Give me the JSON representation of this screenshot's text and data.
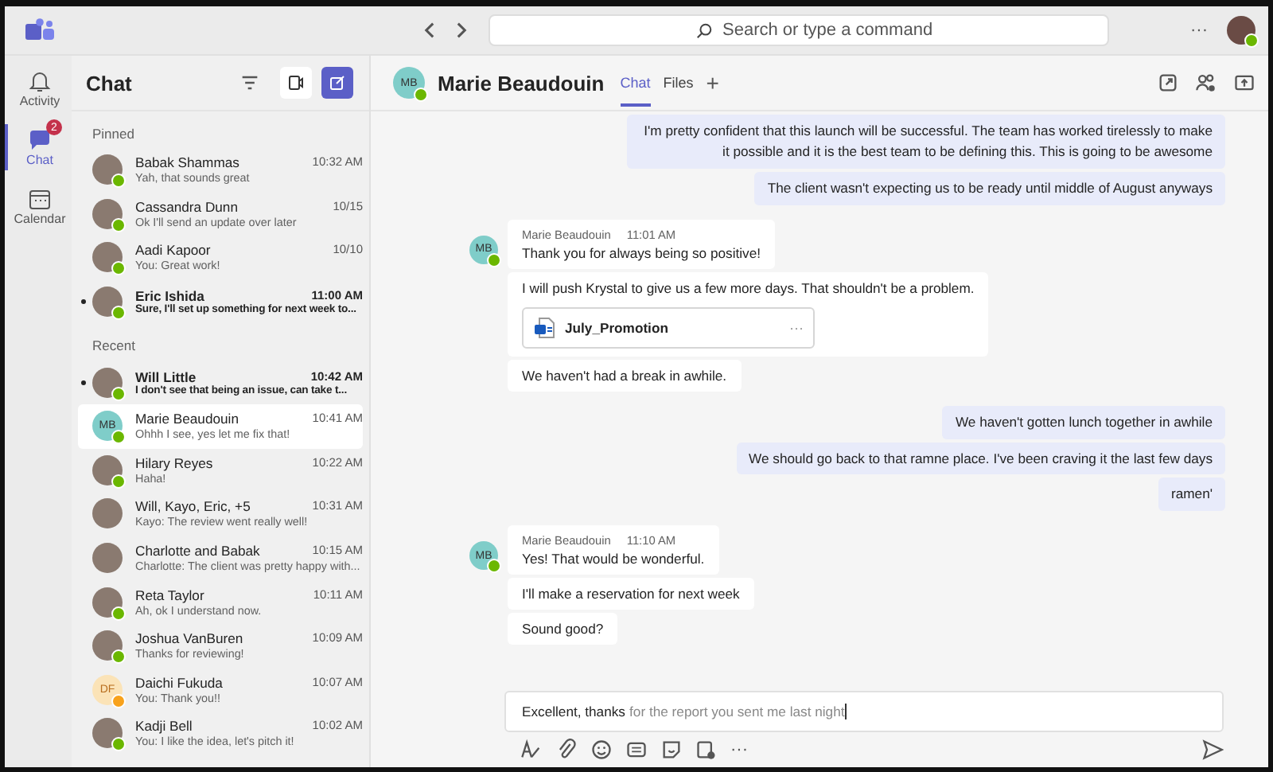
{
  "top_bar": {
    "search": {
      "placeholder": "Search or type a command"
    },
    "more": "···"
  },
  "rail": [
    {
      "label": "Activity",
      "selected": false
    },
    {
      "label": "Chat",
      "selected": true,
      "badge": "2"
    },
    {
      "label": "Calendar",
      "selected": false
    }
  ],
  "chat_list": {
    "title": "Chat",
    "sections": [
      {
        "label": "Pinned",
        "items": [
          {
            "name": "Babak Shammas",
            "time": "10:32 AM",
            "preview": "Yah, that sounds great",
            "unread": false,
            "selected": false,
            "color": "#6bb700"
          },
          {
            "name": "Cassandra Dunn",
            "time": "10/15",
            "preview": "Ok I'll send an update over later",
            "unread": false,
            "selected": false,
            "color": "#6bb700"
          },
          {
            "name": "Aadi Kapoor",
            "time": "10/10",
            "preview": "You: Great work!",
            "unread": false,
            "selected": false,
            "color": "#6bb700"
          },
          {
            "name": "Eric Ishida",
            "time": "11:00 AM",
            "preview": "Sure, I'll set up something for next week to...",
            "unread": true,
            "selected": false,
            "color": "#6bb700"
          }
        ]
      },
      {
        "label": "Recent",
        "items": [
          {
            "name": "Will Little",
            "time": "10:42 AM",
            "preview": "I don't see that being an issue, can take t...",
            "unread": true,
            "selected": false,
            "color": "#6bb700"
          },
          {
            "name": "Marie Beaudouin",
            "initials": "MB",
            "time": "10:41 AM",
            "preview": "Ohhh I see, yes let me fix that!",
            "unread": false,
            "selected": true,
            "color": "#6bb700"
          },
          {
            "name": "Hilary Reyes",
            "time": "10:22 AM",
            "preview": "Haha!",
            "unread": false,
            "selected": false,
            "color": "#6bb700"
          },
          {
            "name": "Will, Kayo, Eric, +5",
            "time": "10:31 AM",
            "preview": "Kayo: The review went really well!",
            "unread": false,
            "selected": false
          },
          {
            "name": "Charlotte and Babak",
            "time": "10:15 AM",
            "preview": "Charlotte: The client was pretty happy with...",
            "unread": false,
            "selected": false
          },
          {
            "name": "Reta Taylor",
            "time": "10:11 AM",
            "preview": "Ah, ok I understand now.",
            "unread": false,
            "selected": false,
            "color": "#6bb700"
          },
          {
            "name": "Joshua VanBuren",
            "time": "10:09 AM",
            "preview": "Thanks for reviewing!",
            "unread": false,
            "selected": false,
            "color": "#6bb700"
          },
          {
            "name": "Daichi Fukuda",
            "initials": "DF",
            "time": "10:07 AM",
            "preview": "You: Thank you!!",
            "unread": false,
            "selected": false,
            "color": "#f8a21c"
          },
          {
            "name": "Kadji Bell",
            "time": "10:02 AM",
            "preview": "You: I like the idea, let's pitch it!",
            "unread": false,
            "selected": false,
            "color": "#6bb700"
          }
        ]
      }
    ]
  },
  "conversation": {
    "name": "Marie Beaudouin",
    "initials": "MB",
    "color": "#6bb700",
    "tabs": [
      {
        "label": "Chat",
        "selected": true
      },
      {
        "label": "Files",
        "selected": false
      }
    ],
    "add_tab": "+",
    "messages": [
      {
        "kind": "outgoing",
        "texts": [
          "I'm pretty confident that this launch will be successful. The team has worked tirelessly to make it possible and it is the best team to be defining this. This is going to be awesome",
          "The client wasn't expecting us to be ready until middle of August anyways"
        ]
      },
      {
        "kind": "incoming",
        "author": "Marie Beaudouin",
        "initials": "MB",
        "time": "11:01 AM",
        "items": [
          {
            "kind": "text",
            "text": "Thank you for always being so positive!"
          },
          {
            "kind": "text",
            "text": "I will push Krystal to give us a few more days. That shouldn't be a problem.",
            "attachment": {
              "name": "July_Promotion",
              "more": "···"
            }
          },
          {
            "kind": "text",
            "text": "We haven't had a break in awhile."
          }
        ]
      },
      {
        "kind": "outgoing",
        "texts": [
          "We haven't gotten lunch together in awhile",
          "We should go back to that ramne place. I've been craving it the last few days",
          "ramen'"
        ]
      },
      {
        "kind": "incoming",
        "author": "Marie Beaudouin",
        "initials": "MB",
        "time": "11:10 AM",
        "items": [
          {
            "kind": "text",
            "text": "Yes! That would be wonderful."
          },
          {
            "kind": "text",
            "text": "I'll make a reservation for next week"
          },
          {
            "kind": "text",
            "text": "Sound good?"
          }
        ]
      }
    ],
    "compose": {
      "value": "Excellent, thanks",
      "suggestion": "for the report you sent me last night",
      "more": "···"
    }
  }
}
